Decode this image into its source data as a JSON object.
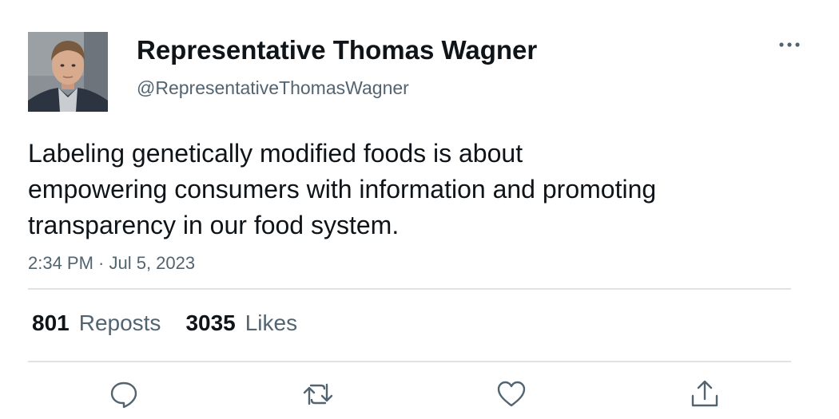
{
  "author": {
    "name": "Representative Thomas Wagner",
    "handle": "@RepresentativeThomasWagner"
  },
  "tweet": {
    "lines": [
      "Labeling genetically modified foods is about",
      "empowering consumers with information and promoting",
      "transparency in our food system."
    ],
    "timestamp": "2:34 PM · Jul 5, 2023"
  },
  "stats": {
    "reposts_count": "801",
    "reposts_label": "Reposts",
    "likes_count": "3035",
    "likes_label": "Likes"
  },
  "actions": [
    "reply-icon",
    "repost-icon",
    "like-icon",
    "share-icon"
  ],
  "colors": {
    "text": "#0f1419",
    "secondary": "#536471",
    "divider": "#dfe3e6"
  }
}
